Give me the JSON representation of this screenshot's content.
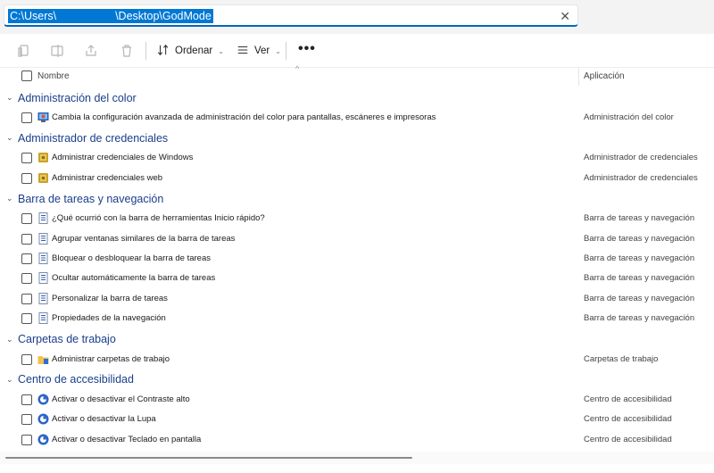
{
  "address": {
    "path": "C:\\Users\\                   \\Desktop\\GodMode",
    "clear_label": "✕"
  },
  "toolbar": {
    "sort_label": "Ordenar",
    "view_label": "Ver",
    "more_label": "•••",
    "icons": [
      "copy-icon",
      "rename-icon",
      "share-icon",
      "delete-icon",
      "sort-icon",
      "view-icon"
    ]
  },
  "columns": {
    "name": "Nombre",
    "app": "Aplicación",
    "sort_caret": "^"
  },
  "groups": [
    {
      "title": "Administración del color",
      "items": [
        {
          "name": "Cambia la configuración avanzada de administración del color para pantallas, escáneres e impresoras",
          "app": "Administración del color",
          "icon": "color-management-icon"
        }
      ]
    },
    {
      "title": "Administrador de credenciales",
      "items": [
        {
          "name": "Administrar credenciales de Windows",
          "app": "Administrador de credenciales",
          "icon": "credential-icon"
        },
        {
          "name": "Administrar credenciales web",
          "app": "Administrador de credenciales",
          "icon": "credential-icon"
        }
      ]
    },
    {
      "title": "Barra de tareas y navegación",
      "items": [
        {
          "name": "¿Qué ocurrió con la barra de herramientas Inicio rápido?",
          "app": "Barra de tareas y navegación",
          "icon": "taskbar-icon"
        },
        {
          "name": "Agrupar ventanas similares de la barra de tareas",
          "app": "Barra de tareas y navegación",
          "icon": "taskbar-icon"
        },
        {
          "name": "Bloquear o desbloquear la barra de tareas",
          "app": "Barra de tareas y navegación",
          "icon": "taskbar-icon"
        },
        {
          "name": "Ocultar automáticamente la barra de tareas",
          "app": "Barra de tareas y navegación",
          "icon": "taskbar-icon"
        },
        {
          "name": "Personalizar la barra de tareas",
          "app": "Barra de tareas y navegación",
          "icon": "taskbar-icon"
        },
        {
          "name": "Propiedades de la navegación",
          "app": "Barra de tareas y navegación",
          "icon": "taskbar-icon"
        }
      ]
    },
    {
      "title": "Carpetas de trabajo",
      "items": [
        {
          "name": "Administrar carpetas de trabajo",
          "app": "Carpetas de trabajo",
          "icon": "work-folders-icon"
        }
      ]
    },
    {
      "title": "Centro de accesibilidad",
      "items": [
        {
          "name": "Activar o desactivar el Contraste alto",
          "app": "Centro de accesibilidad",
          "icon": "accessibility-icon"
        },
        {
          "name": "Activar o desactivar la Lupa",
          "app": "Centro de accesibilidad",
          "icon": "accessibility-icon"
        },
        {
          "name": "Activar o desactivar Teclado en pantalla",
          "app": "Centro de accesibilidad",
          "icon": "accessibility-icon"
        }
      ]
    }
  ]
}
